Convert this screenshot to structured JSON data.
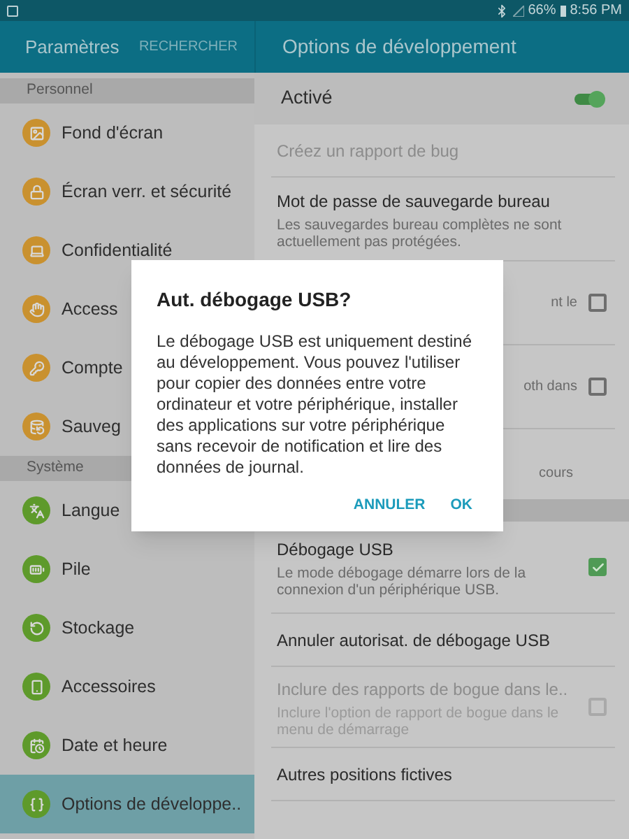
{
  "status_bar": {
    "battery": "66%",
    "time": "8:56 PM"
  },
  "sidebar": {
    "title": "Paramètres",
    "search_button": "RECHERCHER",
    "sections": [
      {
        "title": "Personnel",
        "items": [
          {
            "label": "Fond d'écran",
            "color": "#c9912f",
            "selected": false
          },
          {
            "label": "Écran verr. et sécurité",
            "color": "#c9912f",
            "selected": false
          },
          {
            "label": "Confidentialité",
            "color": "#c9912f",
            "selected": false
          },
          {
            "label": "Access",
            "color": "#c9912f",
            "selected": false
          },
          {
            "label": "Compte",
            "color": "#c9912f",
            "selected": false
          },
          {
            "label": "Sauveg",
            "color": "#c9912f",
            "selected": false
          }
        ]
      },
      {
        "title": "Système",
        "items": [
          {
            "label": "Langue",
            "color": "#5e9a2b",
            "selected": false
          },
          {
            "label": "Pile",
            "color": "#5e9a2b",
            "selected": false
          },
          {
            "label": "Stockage",
            "color": "#5e9a2b",
            "selected": false
          },
          {
            "label": "Accessoires",
            "color": "#5e9a2b",
            "selected": false
          },
          {
            "label": "Date et heure",
            "color": "#5e9a2b",
            "selected": false
          },
          {
            "label": "Options de développe..",
            "color": "#5e9a2b",
            "selected": true
          }
        ]
      }
    ]
  },
  "content": {
    "title": "Options de développement",
    "master_switch": {
      "label": "Activé",
      "on": true
    },
    "rows": [
      {
        "kind": "plain",
        "title": "Créez un rapport de bug",
        "disabled": true
      },
      {
        "kind": "plain",
        "title": "Mot de passe de sauvegarde bureau",
        "subtitle": "Les sauvegardes bureau complètes ne sont actuellement pas protégées.",
        "disabled": false
      },
      {
        "kind": "covered-checkbox",
        "subtitle": "nt le",
        "checked": false
      },
      {
        "kind": "covered-checkbox",
        "subtitle": "oth dans",
        "checked": false
      },
      {
        "kind": "covered",
        "subtitle": "cours"
      },
      {
        "kind": "section"
      },
      {
        "kind": "checkbox",
        "title": "Débogage USB",
        "subtitle": "Le mode débogage démarre lors de la connexion d'un périphérique USB.",
        "checked": true,
        "disabled": false
      },
      {
        "kind": "plain",
        "title": "Annuler autorisat. de débogage USB",
        "disabled": false
      },
      {
        "kind": "checkbox",
        "title": "Inclure des rapports de bogue dans le..",
        "subtitle": "Inclure l'option de rapport de bogue dans le menu de démarrage",
        "checked": false,
        "disabled": true
      },
      {
        "kind": "plain",
        "title": "Autres positions fictives",
        "disabled": false
      }
    ]
  },
  "dialog": {
    "title": "Aut. débogage USB?",
    "body": "Le débogage USB est uniquement destiné au développement. Vous pouvez l'utiliser pour copier des données entre votre ordinateur et votre périphérique, installer des applications sur votre périphérique sans recevoir de notification et lire des données de journal.",
    "buttons": [
      "ANNULER",
      "OK"
    ]
  }
}
